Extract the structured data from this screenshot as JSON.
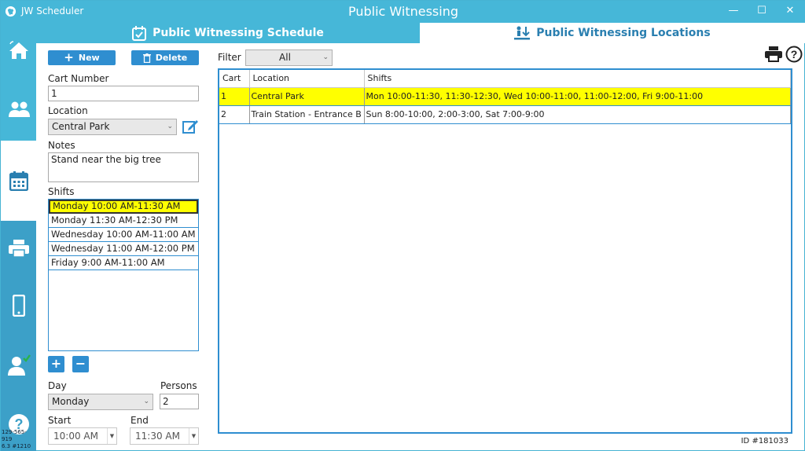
{
  "window": {
    "app_name": "JW Scheduler",
    "title": "Public Witnessing",
    "minimize": "—",
    "maximize": "☐",
    "close": "✕"
  },
  "tabs": [
    {
      "label": "Public Witnessing Schedule",
      "icon": "calendar-check-icon"
    },
    {
      "label": "Public Witnessing Locations",
      "icon": "person-location-icon"
    }
  ],
  "sidebar": {
    "items": [
      "home-icon",
      "people-icon",
      "calendar-icon",
      "printer-icon",
      "phone-icon",
      "user-check-icon",
      "help-icon"
    ],
    "footer_line1": "129-565-919",
    "footer_line2": "6.3 #1210"
  },
  "toolbar": {
    "new_label": "New",
    "delete_label": "Delete"
  },
  "form": {
    "cart_number_label": "Cart Number",
    "cart_number_value": "1",
    "location_label": "Location",
    "location_value": "Central Park",
    "notes_label": "Notes",
    "notes_value": "Stand near the big tree",
    "shifts_label": "Shifts",
    "shifts": [
      "Monday 10:00 AM-11:30 AM",
      "Monday 11:30 AM-12:30 PM",
      "Wednesday 10:00 AM-11:00 AM",
      "Wednesday 11:00 AM-12:00 PM",
      "Friday 9:00 AM-11:00 AM"
    ],
    "add_symbol": "+",
    "remove_symbol": "−",
    "day_label": "Day",
    "day_value": "Monday",
    "persons_label": "Persons",
    "persons_value": "2",
    "start_label": "Start",
    "start_value": "10:00 AM",
    "end_label": "End",
    "end_value": "11:30 AM"
  },
  "filter": {
    "label": "Filter",
    "value": "All"
  },
  "table": {
    "headers": [
      "Cart",
      "Location",
      "Shifts"
    ],
    "rows": [
      [
        "1",
        "Central Park",
        "Mon 10:00-11:30, 11:30-12:30, Wed 10:00-11:00, 11:00-12:00, Fri 9:00-11:00"
      ],
      [
        "2",
        "Train Station - Entrance B",
        "Sun 8:00-10:00, 2:00-3:00, Sat 7:00-9:00"
      ]
    ]
  },
  "footer": {
    "id_label": "ID #181033"
  },
  "colors": {
    "accent": "#46b7d8",
    "button": "#2f8ed0",
    "highlight": "#ffff00"
  }
}
